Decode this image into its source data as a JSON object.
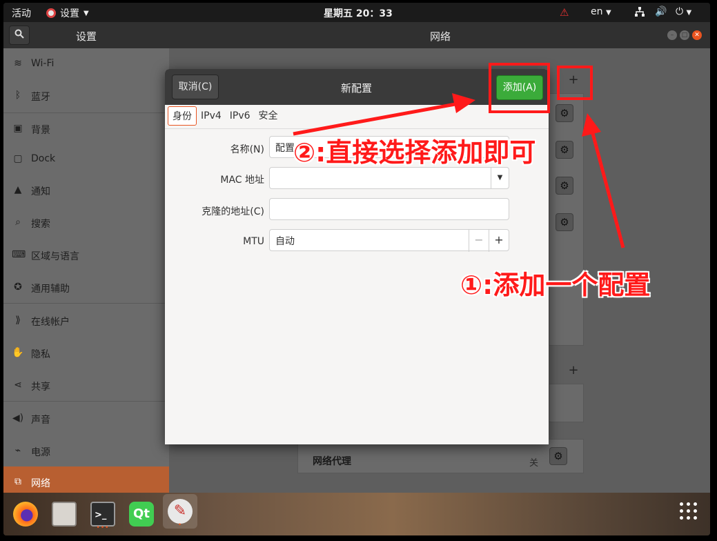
{
  "topbar": {
    "activities": "活动",
    "app_name": "设置",
    "clock": "星期五 20：33",
    "lang": "en"
  },
  "header": {
    "left_title": "设置",
    "center_title": "网络"
  },
  "sidebar": {
    "items": [
      {
        "label": "Wi-Fi",
        "icon": "wifi-icon"
      },
      {
        "label": "蓝牙",
        "icon": "bluetooth-icon"
      },
      {
        "label": "背景",
        "icon": "background-icon"
      },
      {
        "label": "Dock",
        "icon": "dock-icon"
      },
      {
        "label": "通知",
        "icon": "bell-icon"
      },
      {
        "label": "搜索",
        "icon": "search-icon"
      },
      {
        "label": "区域与语言",
        "icon": "keyboard-icon"
      },
      {
        "label": "通用辅助",
        "icon": "accessibility-icon"
      },
      {
        "label": "在线帐户",
        "icon": "online-accounts-icon"
      },
      {
        "label": "隐私",
        "icon": "hand-icon"
      },
      {
        "label": "共享",
        "icon": "share-icon"
      },
      {
        "label": "声音",
        "icon": "speaker-icon"
      },
      {
        "label": "电源",
        "icon": "power-plug-icon"
      },
      {
        "label": "网络",
        "icon": "network-icon"
      }
    ],
    "active_index": 13
  },
  "main": {
    "proxy_label": "网络代理",
    "proxy_state": "关"
  },
  "dialog": {
    "cancel_label": "取消(C)",
    "title": "新配置",
    "add_label": "添加(A)",
    "tabs": [
      "身份",
      "IPv4",
      "IPv6",
      "安全"
    ],
    "active_tab": 0,
    "fields": {
      "name_label": "名称(N)",
      "name_value": "配置",
      "mac_label": "MAC 地址",
      "mac_value": "",
      "cloned_label": "克隆的地址(C)",
      "cloned_value": "",
      "mtu_label": "MTU",
      "mtu_value": "自动"
    }
  },
  "annotations": {
    "step1": "①:添加一个配置",
    "step2": "②:直接选择添加即可"
  },
  "dock": {
    "apps": [
      "firefox-icon",
      "files-icon",
      "terminal-icon",
      "qt-creator-icon",
      "settings-icon"
    ]
  },
  "colors": {
    "accent": "#e95420",
    "add_button": "#3bab3a",
    "annotation_red": "#ff1a1a"
  }
}
